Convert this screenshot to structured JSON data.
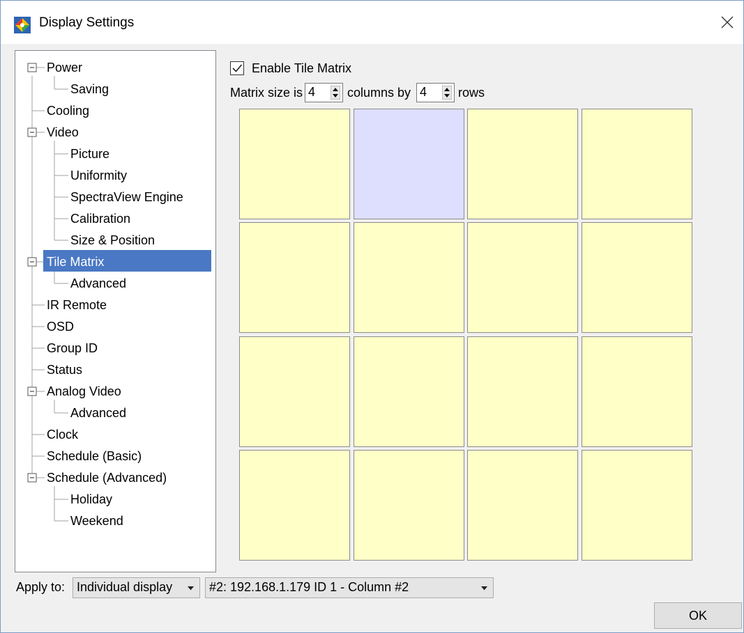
{
  "window": {
    "title": "Display Settings"
  },
  "tree": {
    "items": [
      {
        "label": "Power",
        "expanded": true
      },
      {
        "label": "Saving"
      },
      {
        "label": "Cooling"
      },
      {
        "label": "Video",
        "expanded": true
      },
      {
        "label": "Picture"
      },
      {
        "label": "Uniformity"
      },
      {
        "label": "SpectraView Engine"
      },
      {
        "label": "Calibration"
      },
      {
        "label": "Size & Position"
      },
      {
        "label": "Tile Matrix",
        "expanded": true,
        "selected": true
      },
      {
        "label": "Advanced"
      },
      {
        "label": "IR Remote"
      },
      {
        "label": "OSD"
      },
      {
        "label": "Group ID"
      },
      {
        "label": "Status"
      },
      {
        "label": "Analog Video",
        "expanded": true
      },
      {
        "label": "Advanced"
      },
      {
        "label": "Clock"
      },
      {
        "label": "Schedule (Basic)"
      },
      {
        "label": "Schedule (Advanced)",
        "expanded": true
      },
      {
        "label": "Holiday"
      },
      {
        "label": "Weekend"
      }
    ]
  },
  "tile_matrix": {
    "enable_label": "Enable Tile Matrix",
    "enabled": true,
    "size_prefix": "Matrix size is",
    "columns_value": "4",
    "columns_text": "columns by",
    "rows_value": "4",
    "rows_text": "rows",
    "selected_tile": {
      "row": 1,
      "column": 2
    }
  },
  "footer": {
    "apply_label": "Apply to:",
    "apply_value": "Individual display",
    "display_value": "#2: 192.168.1.179 ID 1 - Column #2",
    "ok_label": "OK"
  },
  "colors": {
    "tile": "#ffffc8",
    "tile_selected": "#dedeff",
    "selection": "#4a78c4"
  },
  "icons": [
    "app-color-icon",
    "close-icon",
    "checkmark-icon",
    "collapse-minus-icon",
    "spin-arrows-icon",
    "dropdown-arrow-icon"
  ]
}
